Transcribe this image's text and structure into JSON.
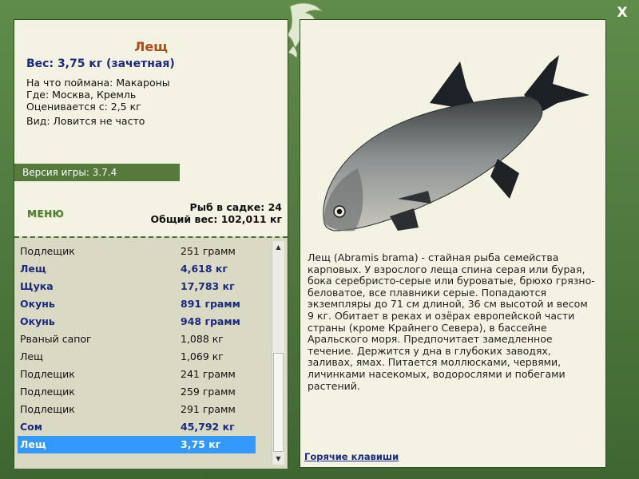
{
  "window": {
    "close_label": "X"
  },
  "fish": {
    "title": "Лещ",
    "weight": "Вес: 3,75 кг (зачетная)",
    "caught_on": "На что поймана: Макароны",
    "where": "Где: Москва, Кремль",
    "rated_from": "Оценивается с: 2,5 кг",
    "type": "Вид: Ловится не часто"
  },
  "version": "Версия игры: 3.7.4",
  "menu_label": "МЕНЮ",
  "stats": {
    "fish_in_keepnet": "Рыб в садке: 24",
    "total_weight": "Общий вес: 102,011 кг"
  },
  "catch_list": [
    {
      "name": "Подлещик",
      "weight": "251 грамм",
      "style": "normal"
    },
    {
      "name": "Лещ",
      "weight": "4,618 кг",
      "style": "bold"
    },
    {
      "name": "Щука",
      "weight": "17,783 кг",
      "style": "bold"
    },
    {
      "name": "Окунь",
      "weight": "891 грамм",
      "style": "bold"
    },
    {
      "name": "Окунь",
      "weight": "948 грамм",
      "style": "bold"
    },
    {
      "name": "Рваный сапог",
      "weight": "1,088 кг",
      "style": "normal"
    },
    {
      "name": "Лещ",
      "weight": "1,069 кг",
      "style": "normal"
    },
    {
      "name": "Подлещик",
      "weight": "241 грамм",
      "style": "normal"
    },
    {
      "name": "Подлещик",
      "weight": "259 грамм",
      "style": "normal"
    },
    {
      "name": "Подлещик",
      "weight": "291 грамм",
      "style": "normal"
    },
    {
      "name": "Сом",
      "weight": "45,792 кг",
      "style": "bold"
    },
    {
      "name": "Лещ",
      "weight": "3,75 кг",
      "style": "selected"
    }
  ],
  "description": "Лещ (Abramis brama) - стайная рыба семейства карповых. У взрослого леща спина серая или бурая, бока серебристо-серые или буроватые, брюхо грязно-беловатое, все плавники серые. Попадаются экземпляры до 71 см длиной, 36 см высотой и весом 9 кг. Обитает в реках и озёрах европейской части страны (кроме Крайнего Севера), в бассейне Аральского моря. Предпочитает замедленное течение. Держится у дна в глубоких заводях, заливах, ямах. Питается моллюсками, червями, личинками насекомых, водорослями и побегами растений.",
  "hotkeys_label": "Горячие клавиши",
  "colors": {
    "frame_green": "#4e7a3e",
    "panel_bg": "#f4f3e3",
    "title_orange": "#b34a12",
    "navy_text": "#1c2a7e",
    "selected_blue": "#3399ff"
  }
}
